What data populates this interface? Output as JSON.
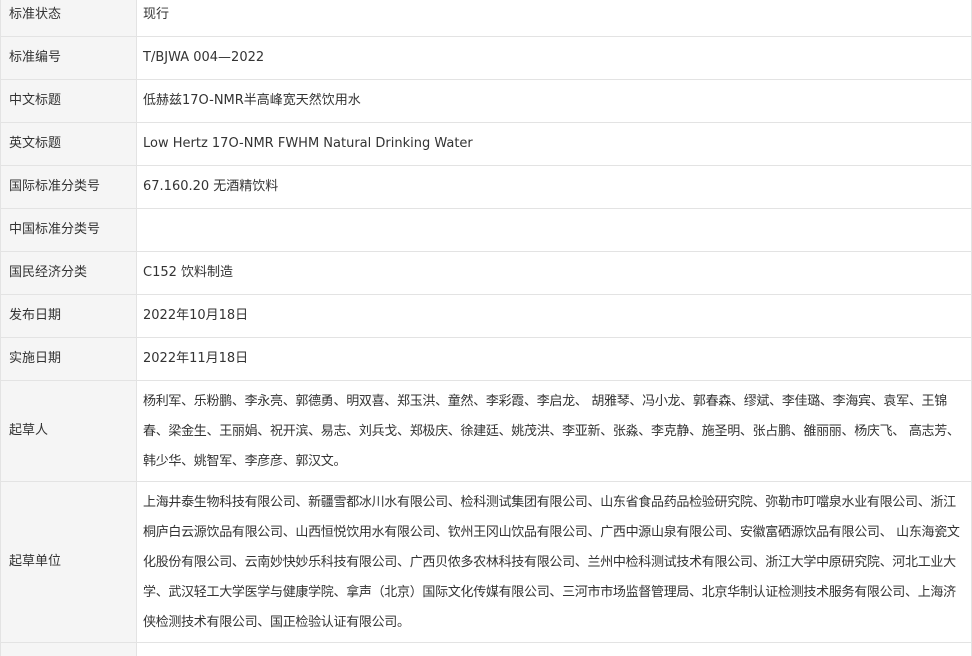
{
  "rows": [
    {
      "label": "标准状态",
      "value": "现行"
    },
    {
      "label": "标准编号",
      "value": "T/BJWA 004—2022"
    },
    {
      "label": "中文标题",
      "value": "低赫兹17O-NMR半高峰宽天然饮用水"
    },
    {
      "label": "英文标题",
      "value": "Low Hertz 17O-NMR FWHM Natural Drinking Water"
    },
    {
      "label": "国际标准分类号",
      "value": "67.160.20 无酒精饮料"
    },
    {
      "label": "中国标准分类号",
      "value": ""
    },
    {
      "label": "国民经济分类",
      "value": "C152 饮料制造"
    },
    {
      "label": "发布日期",
      "value": "2022年10月18日"
    },
    {
      "label": "实施日期",
      "value": "2022年11月18日"
    },
    {
      "label": "起草人",
      "value": "杨利军、乐粉鹏、李永亮、郭德勇、明双喜、郑玉洪、童然、李彩霞、李启龙、 胡雅琴、冯小龙、郭春森、缪斌、李佳璐、李海宾、袁军、王锦春、梁金生、王丽娟、祝开滨、易志、刘兵戈、郑极庆、徐建廷、姚茂洪、李亚新、张淼、李克静、施圣明、张占鹏、雒丽丽、杨庆飞、 高志芳、韩少华、姚智军、李彦彦、郭汉文。"
    },
    {
      "label": "起草单位",
      "value": "上海井泰生物科技有限公司、新疆雪都冰川水有限公司、检科测试集团有限公司、山东省食品药品检验研究院、弥勒市叮噹泉水业有限公司、浙江桐庐白云源饮品有限公司、山西恒悦饮用水有限公司、钦州王冈山饮品有限公司、广西中源山泉有限公司、安徽富硒源饮品有限公司、 山东海瓷文化股份有限公司、云南妙快妙乐科技有限公司、广西贝侬多农林科技有限公司、兰州中检科测试技术有限公司、浙江大学中原研究院、河北工业大学、武汉轻工大学医学与健康学院、拿声（北京）国际文化传媒有限公司、三河市市场监督管理局、北京华制认证检测技术服务有限公司、上海济侠检测技术有限公司、国正检验认证有限公司。"
    },
    {
      "label": "",
      "value": ""
    }
  ]
}
